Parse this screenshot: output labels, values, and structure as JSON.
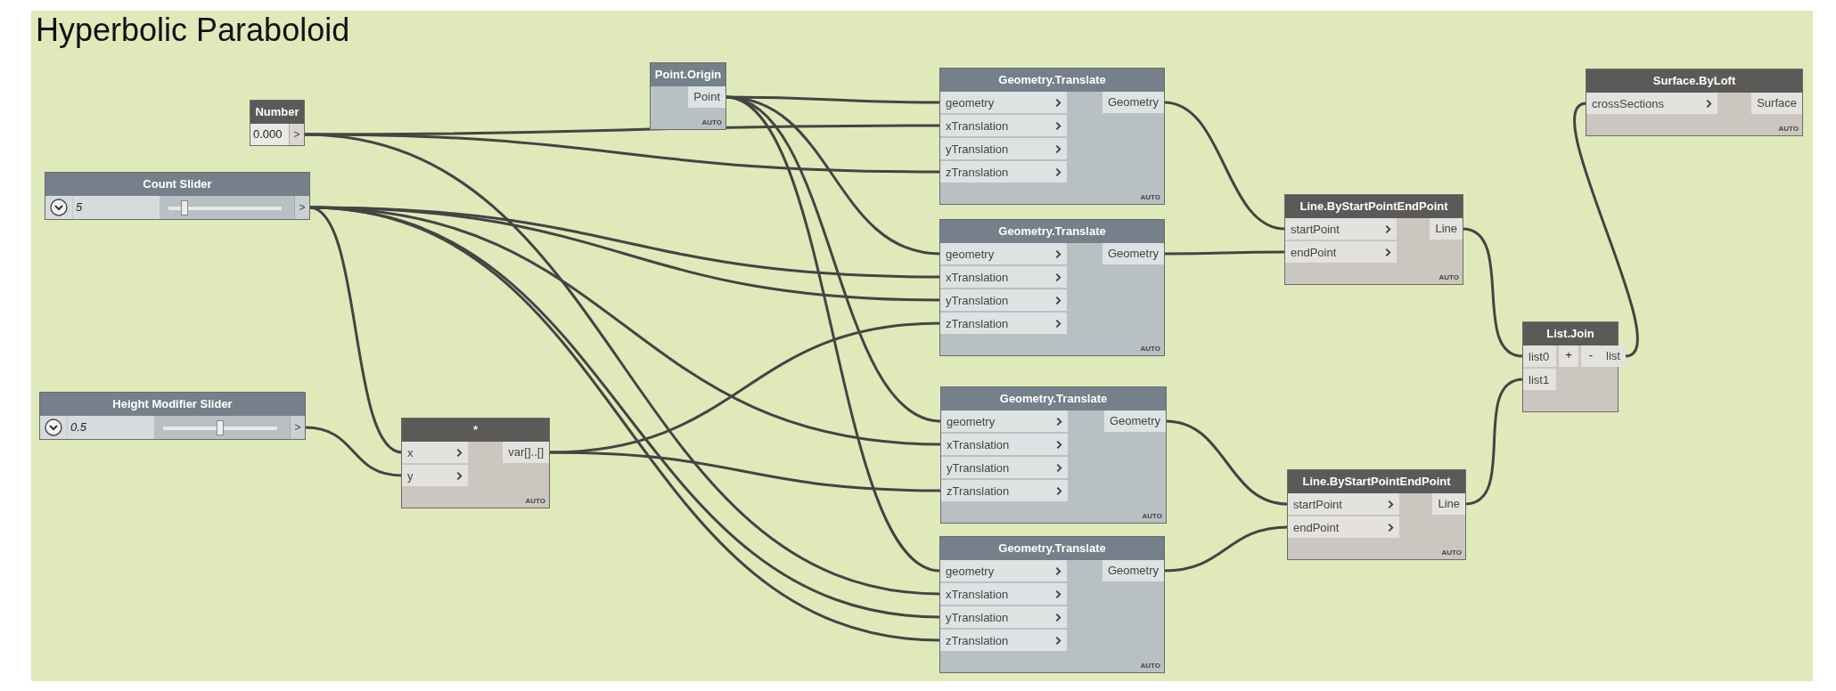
{
  "group": {
    "title": "Hyperbolic Paraboloid"
  },
  "nodes": [
    {
      "kind": "number",
      "title": "Number",
      "selected": false,
      "value": "0.000",
      "output": ">"
    },
    {
      "kind": "slider",
      "title": "Count Slider",
      "selected": true,
      "value": "5",
      "level": 0.14,
      "output": ">"
    },
    {
      "kind": "slider",
      "title": "Height Modifier Slider",
      "selected": true,
      "value": "0.5",
      "level": 0.5,
      "output": ">"
    },
    {
      "kind": "function",
      "title": "Point.Origin",
      "selected": true,
      "outputs": [
        "Point"
      ],
      "lacing": "AUTO"
    },
    {
      "kind": "function",
      "title": "*",
      "selected": false,
      "inputs": [
        {
          "label": "x"
        },
        {
          "label": "y"
        }
      ],
      "outputs": [
        "var[]..[]"
      ],
      "lacing": "AUTO"
    },
    {
      "kind": "function",
      "title": "Geometry.Translate",
      "selected": true,
      "inputs": [
        {
          "label": "geometry"
        },
        {
          "label": "xTranslation"
        },
        {
          "label": "yTranslation"
        },
        {
          "label": "zTranslation"
        }
      ],
      "outputs": [
        "Geometry"
      ],
      "lacing": "AUTO"
    },
    {
      "kind": "function",
      "title": "Geometry.Translate",
      "selected": true,
      "inputs": [
        {
          "label": "geometry"
        },
        {
          "label": "xTranslation"
        },
        {
          "label": "yTranslation"
        },
        {
          "label": "zTranslation"
        }
      ],
      "outputs": [
        "Geometry"
      ],
      "lacing": "AUTO"
    },
    {
      "kind": "function",
      "title": "Geometry.Translate",
      "selected": true,
      "inputs": [
        {
          "label": "geometry"
        },
        {
          "label": "xTranslation"
        },
        {
          "label": "yTranslation"
        },
        {
          "label": "zTranslation"
        }
      ],
      "outputs": [
        "Geometry"
      ],
      "lacing": "AUTO"
    },
    {
      "kind": "function",
      "title": "Geometry.Translate",
      "selected": true,
      "inputs": [
        {
          "label": "geometry"
        },
        {
          "label": "xTranslation"
        },
        {
          "label": "yTranslation"
        },
        {
          "label": "zTranslation"
        }
      ],
      "outputs": [
        "Geometry"
      ],
      "lacing": "AUTO"
    },
    {
      "kind": "function",
      "title": "Line.ByStartPointEndPoint",
      "selected": false,
      "inputs": [
        {
          "label": "startPoint"
        },
        {
          "label": "endPoint"
        }
      ],
      "outputs": [
        "Line"
      ],
      "lacing": "AUTO"
    },
    {
      "kind": "function",
      "title": "Line.ByStartPointEndPoint",
      "selected": false,
      "inputs": [
        {
          "label": "startPoint"
        },
        {
          "label": "endPoint"
        }
      ],
      "outputs": [
        "Line"
      ],
      "lacing": "AUTO"
    },
    {
      "kind": "list",
      "title": "List.Join",
      "selected": false,
      "inputs": [
        {
          "label": "list0"
        },
        {
          "label": "list1"
        }
      ],
      "buttons": [
        "+",
        "-"
      ],
      "outputs": [
        "list"
      ]
    },
    {
      "kind": "function",
      "title": "Surface.ByLoft",
      "selected": false,
      "inputs": [
        {
          "label": "crossSections"
        }
      ],
      "outputs": [
        "Surface"
      ],
      "lacing": "AUTO"
    }
  ]
}
